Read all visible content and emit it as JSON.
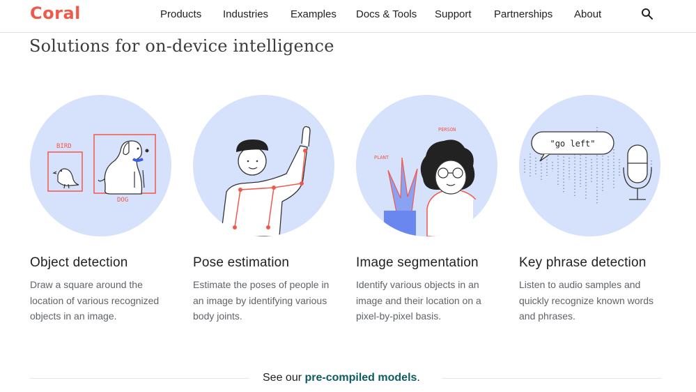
{
  "header": {
    "logo": "Coral",
    "nav": [
      "Products",
      "Industries",
      "Examples",
      "Docs & Tools",
      "Support",
      "Partnerships",
      "About"
    ],
    "search_icon": "search-icon"
  },
  "page_title": "Solutions for on-device intelligence",
  "cards": [
    {
      "title": "Object detection",
      "description": "Draw a square around the location of various recognized objects in an image.",
      "labels": [
        "BIRD",
        "DOG"
      ]
    },
    {
      "title": "Pose estimation",
      "description": "Estimate the poses of people in an image by identifying various body joints."
    },
    {
      "title": "Image segmentation",
      "description": "Identify various objects in an image and their location on a pixel-by-pixel basis.",
      "labels": [
        "PERSON",
        "PLANT"
      ]
    },
    {
      "title": "Key phrase detection",
      "description": "Listen to audio samples and quickly recognize known words and phrases.",
      "bubble": "\"go left\""
    }
  ],
  "footer": {
    "prefix": "See our ",
    "link": "pre-compiled models",
    "suffix": "."
  },
  "colors": {
    "brand": "#f2584a",
    "circle": "#d6e1fb",
    "link": "#0d5c63"
  }
}
